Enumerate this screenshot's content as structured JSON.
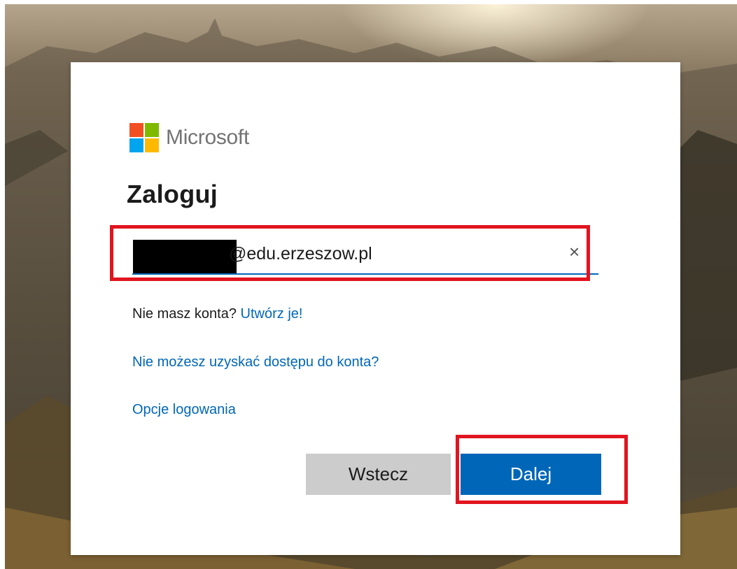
{
  "brand": {
    "name": "Microsoft",
    "logo_colors": [
      "#f25022",
      "#7fba00",
      "#00a4ef",
      "#ffb900"
    ]
  },
  "signin": {
    "title": "Zaloguj",
    "email_value": "@edu.erzeszow.pl",
    "clear_glyph": "×",
    "no_account_text": "Nie masz konta?",
    "create_link": "Utwórz je!",
    "cant_access_link": "Nie możesz uzyskać dostępu do konta?",
    "signin_options_link": "Opcje logowania",
    "back_button": "Wstecz",
    "next_button": "Dalej"
  },
  "colors": {
    "accent": "#0067b8",
    "highlight": "#e1141f",
    "back_button_bg": "#cccccc"
  }
}
